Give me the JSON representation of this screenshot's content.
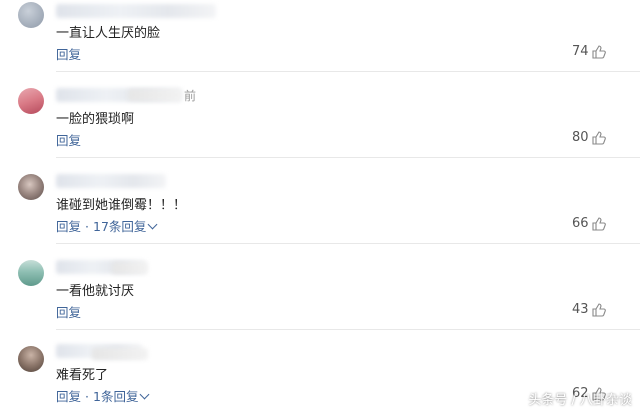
{
  "comments": [
    {
      "content": "一直让人生厌的脸",
      "reply_label": "回复",
      "likes": "74",
      "colors": {
        "avatar_a": "#c9d0d9",
        "avatar_b": "#8e99a8"
      }
    },
    {
      "time_suffix": "前",
      "content": "一脸的猥琐啊",
      "reply_label": "回复",
      "likes": "80",
      "colors": {
        "avatar_a": "#d97a86",
        "avatar_b": "#b54a5c"
      }
    },
    {
      "content": "谁碰到她谁倒霉！！！",
      "reply_label": "回复",
      "replies_label": "17条回复",
      "likes": "66",
      "colors": {
        "avatar_a": "#7a6a66",
        "avatar_b": "#d8c7c0"
      }
    },
    {
      "content": "一看他就讨厌",
      "reply_label": "回复",
      "likes": "43",
      "colors": {
        "avatar_a": "#5f9a8c",
        "avatar_b": "#c7ded8"
      }
    },
    {
      "content": "难看死了",
      "reply_label": "回复",
      "replies_label": "1条回复",
      "likes": "62",
      "colors": {
        "avatar_a": "#6d5a4f",
        "avatar_b": "#c9b3a6"
      }
    }
  ],
  "watermark": "头条号 / 八卦杂谈",
  "colors": {
    "link": "#406599",
    "text": "#222222",
    "muted": "#999999",
    "divider": "#e8e8e8"
  },
  "icons": {
    "thumb": "thumbs-up-icon",
    "chevron": "chevron-down-icon"
  }
}
